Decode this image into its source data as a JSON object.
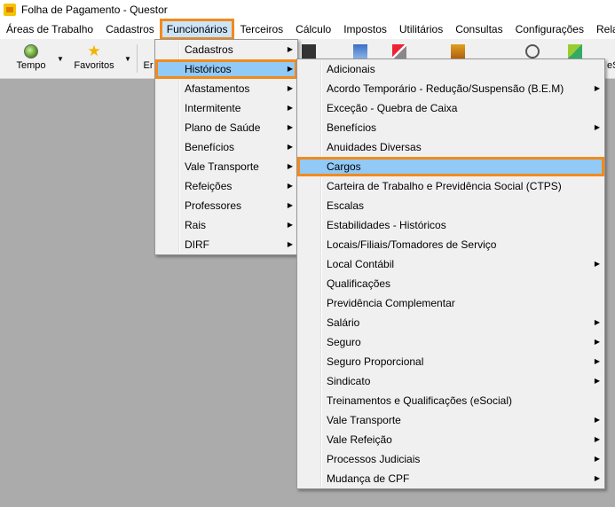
{
  "window": {
    "title": "Folha de Pagamento - Questor"
  },
  "menubar": {
    "items": [
      "Áreas de Trabalho",
      "Cadastros",
      "Funcionários",
      "Terceiros",
      "Cálculo",
      "Impostos",
      "Utilitários",
      "Consultas",
      "Configurações",
      "Relató"
    ]
  },
  "toolbar": {
    "tempo_label": "Tempo",
    "favoritos_label": "Favoritos",
    "partial_label": "Er",
    "partial_right": "eS"
  },
  "funcionarios_menu": {
    "items": [
      {
        "label": "Cadastros",
        "submenu": true
      },
      {
        "label": "Históricos",
        "submenu": true
      },
      {
        "label": "Afastamentos",
        "submenu": true
      },
      {
        "label": "Intermitente",
        "submenu": true
      },
      {
        "label": "Plano de Saúde",
        "submenu": true
      },
      {
        "label": "Benefícios",
        "submenu": true
      },
      {
        "label": "Vale Transporte",
        "submenu": true
      },
      {
        "label": "Refeições",
        "submenu": true
      },
      {
        "label": "Professores",
        "submenu": true
      },
      {
        "label": "Rais",
        "submenu": true
      },
      {
        "label": "DIRF",
        "submenu": true
      }
    ]
  },
  "historicos_menu": {
    "items": [
      {
        "label": "Adicionais",
        "submenu": false
      },
      {
        "label": "Acordo Temporário - Redução/Suspensão (B.E.M)",
        "submenu": true
      },
      {
        "label": "Exceção - Quebra de Caixa",
        "submenu": false
      },
      {
        "label": "Benefícios",
        "submenu": true
      },
      {
        "label": "Anuidades Diversas",
        "submenu": false
      },
      {
        "label": "Cargos",
        "submenu": false
      },
      {
        "label": "Carteira de Trabalho e Previdência Social (CTPS)",
        "submenu": false
      },
      {
        "label": "Escalas",
        "submenu": false
      },
      {
        "label": "Estabilidades - Históricos",
        "submenu": false
      },
      {
        "label": "Locais/Filiais/Tomadores de Serviço",
        "submenu": false
      },
      {
        "label": "Local Contábil",
        "submenu": true
      },
      {
        "label": "Qualificações",
        "submenu": false
      },
      {
        "label": "Previdência Complementar",
        "submenu": false
      },
      {
        "label": "Salário",
        "submenu": true
      },
      {
        "label": "Seguro",
        "submenu": true
      },
      {
        "label": "Seguro Proporcional",
        "submenu": true
      },
      {
        "label": "Sindicato",
        "submenu": true
      },
      {
        "label": "Treinamentos e Qualificações (eSocial)",
        "submenu": false
      },
      {
        "label": "Vale Transporte",
        "submenu": true
      },
      {
        "label": "Vale Refeição",
        "submenu": true
      },
      {
        "label": "Processos Judiciais",
        "submenu": true
      },
      {
        "label": "Mudança de CPF",
        "submenu": true
      }
    ]
  },
  "colors": {
    "highlight": "#91c9f7",
    "callout": "#f28a1c",
    "background": "#ababab"
  }
}
